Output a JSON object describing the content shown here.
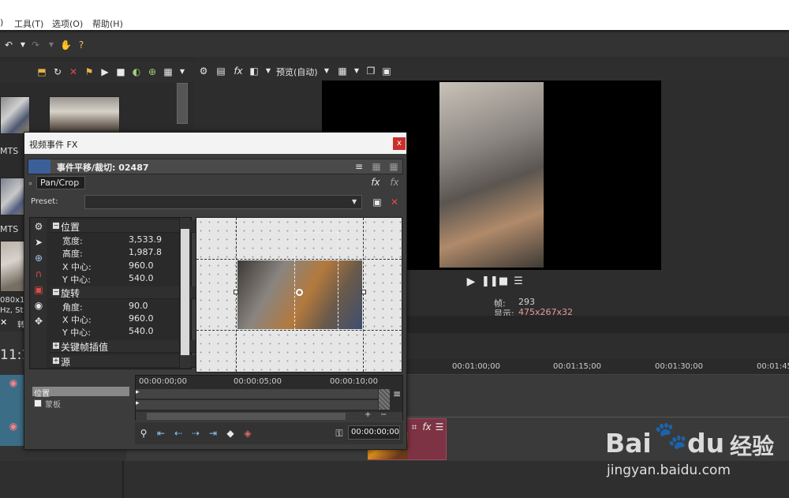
{
  "menu": {
    "items": [
      ")",
      "工具(T)",
      "选项(O)",
      "帮助(H)"
    ]
  },
  "preview_toolbar": {
    "preview_mode": "预览(自动)"
  },
  "left_panel": {
    "clip1_ext": "MTS",
    "clip2_ext": "MTS",
    "info_line1": "080x1",
    "info_line2": "Hz, Ste",
    "info_line3": "转",
    "timecode": "11:1"
  },
  "preview_info": {
    "frame_label": "帧:",
    "frame_value": "293",
    "display_label": "显示:",
    "display_value": "475x267x32"
  },
  "timeline": {
    "ruler_labels": [
      "00:01:00;00",
      "00:01:15;00",
      "00:01:30;00",
      "00:01:45"
    ]
  },
  "dialog": {
    "title": "视频事件 FX",
    "close_label": "x",
    "header_text": "事件平移/裁切: 02487",
    "plugin_tab": "Pan/Crop",
    "preset_label": "Preset:",
    "sections": {
      "position": {
        "title": "位置",
        "props": [
          {
            "label": "宽度:",
            "value": "3,533.9"
          },
          {
            "label": "高度:",
            "value": "1,987.8"
          },
          {
            "label": "X 中心:",
            "value": "960.0"
          },
          {
            "label": "Y 中心:",
            "value": "540.0"
          }
        ]
      },
      "rotation": {
        "title": "旋转",
        "props": [
          {
            "label": "角度:",
            "value": "90.0"
          },
          {
            "label": "X 中心:",
            "value": "960.0"
          },
          {
            "label": "Y 中心:",
            "value": "540.0"
          }
        ]
      },
      "keyframe": {
        "title": "关键帧插值"
      },
      "source": {
        "title": "源"
      }
    },
    "track_labels": {
      "position": "位置",
      "mask": "蒙板"
    },
    "keyframe_times": [
      "00:00:00;00",
      "00:00:05;00",
      "00:00:10;00"
    ],
    "bottom_timecode": "00:00:00;00"
  },
  "watermark": {
    "brand_left": "Bai",
    "brand_right": "du",
    "brand_cn": "经验",
    "url": "jingyan.baidu.com"
  }
}
